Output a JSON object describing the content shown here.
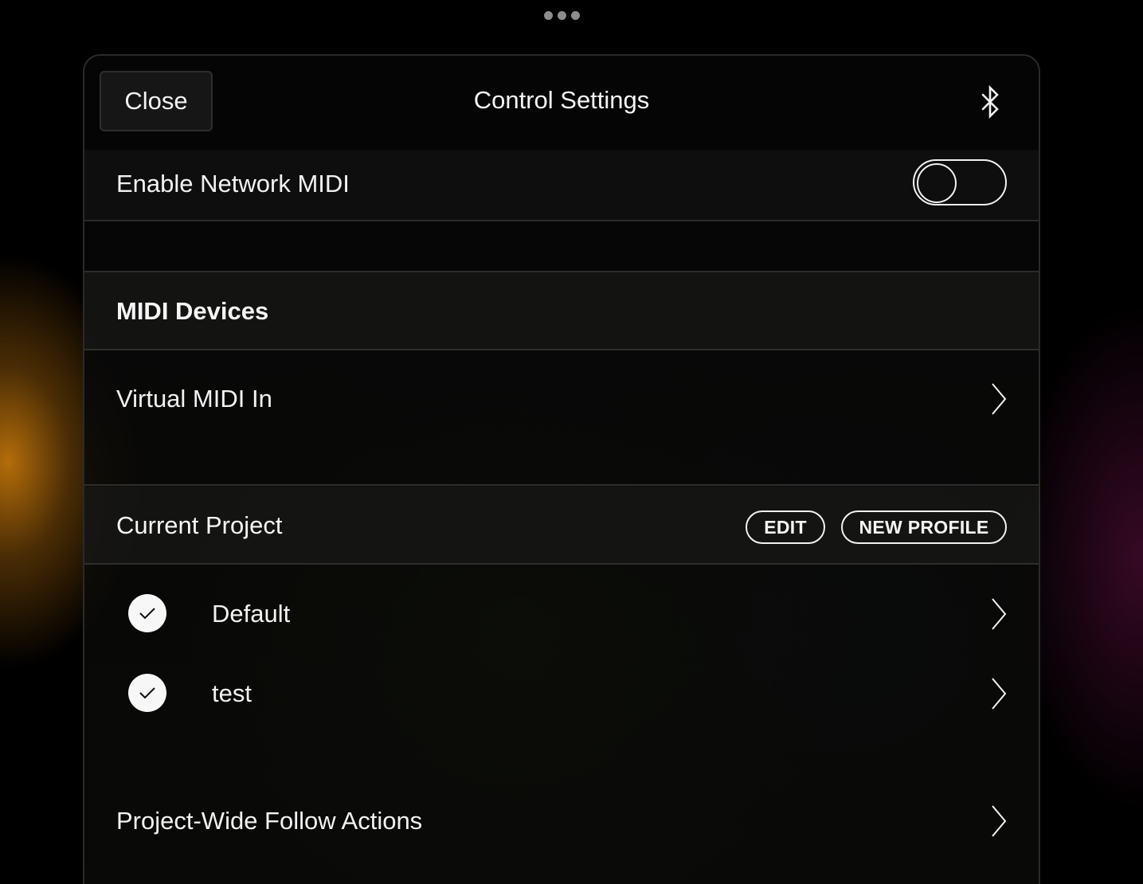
{
  "header": {
    "close_label": "Close",
    "title": "Control Settings",
    "bluetooth_icon": "bluetooth-icon"
  },
  "network_midi": {
    "label": "Enable Network MIDI",
    "enabled": false
  },
  "midi_devices": {
    "section_title": "MIDI Devices",
    "items": [
      {
        "label": "Virtual MIDI In"
      }
    ]
  },
  "current_project": {
    "section_title": "Current Project",
    "edit_label": "EDIT",
    "new_profile_label": "NEW PROFILE",
    "profiles": [
      {
        "label": "Default",
        "checked": true
      },
      {
        "label": "test",
        "checked": true
      }
    ]
  },
  "follow_actions": {
    "label": "Project-Wide Follow Actions"
  },
  "colors": {
    "accent": "#f2f2f2",
    "background": "#000000",
    "glow_left": "#be730a"
  }
}
